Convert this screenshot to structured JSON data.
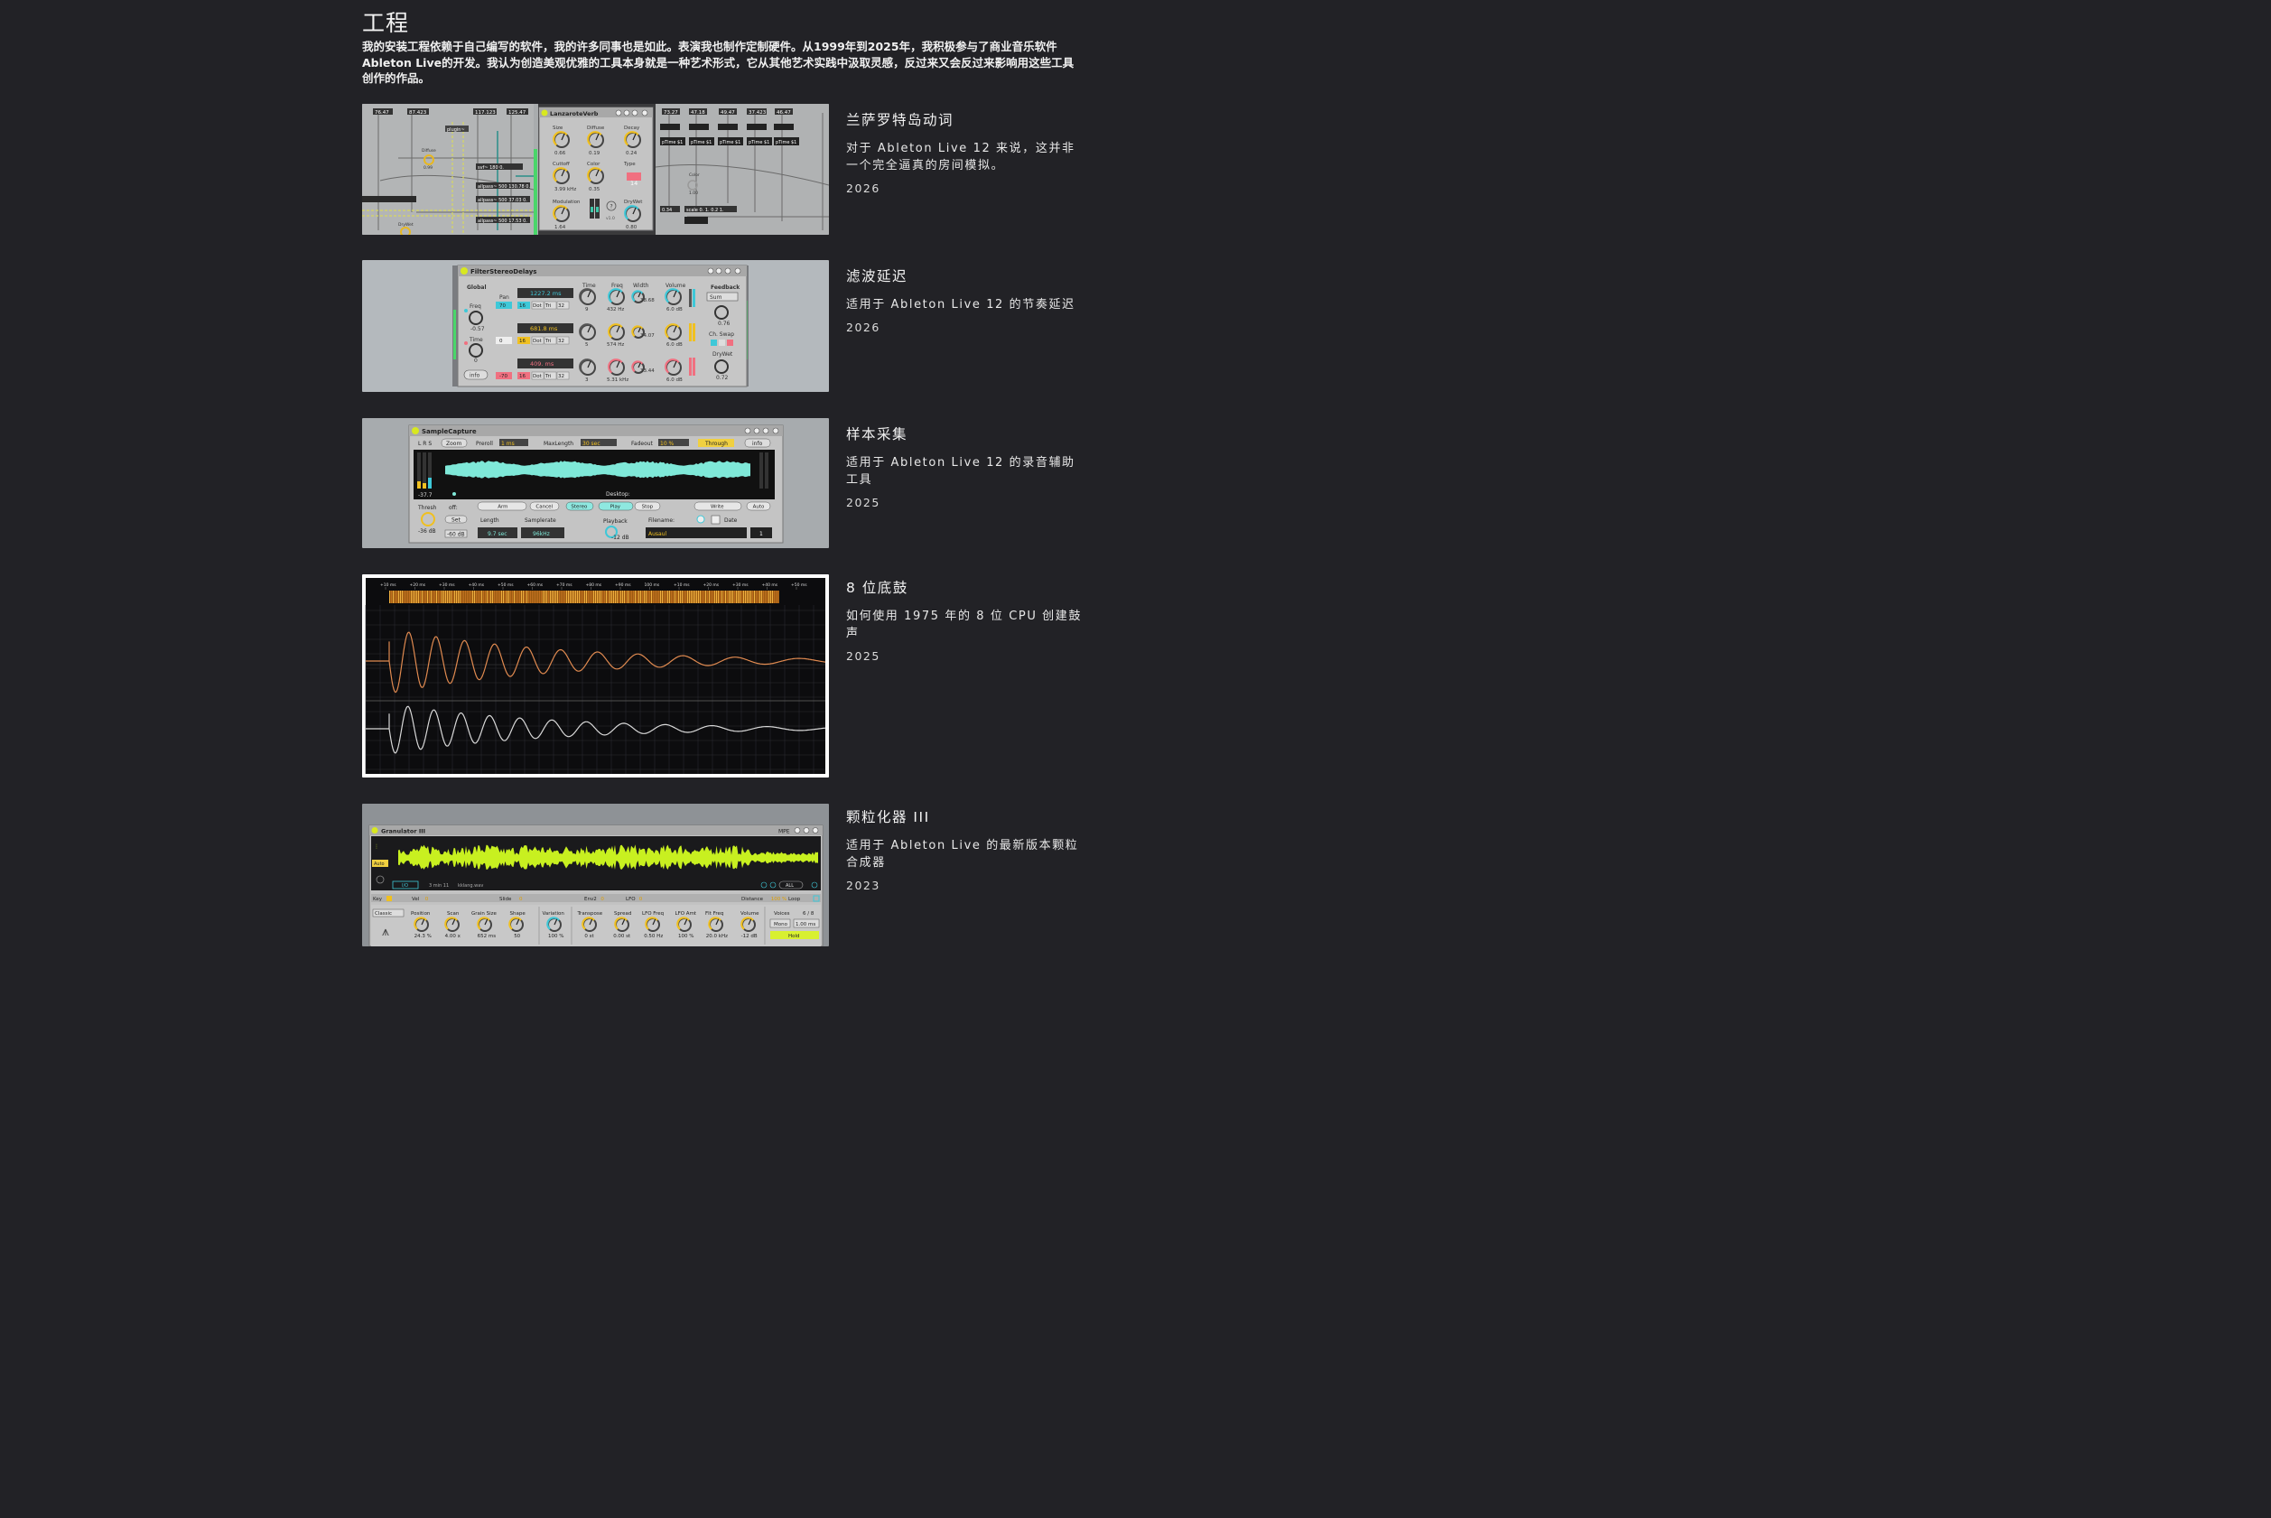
{
  "page": {
    "title": "工程",
    "intro": "我的安装工程依赖于自己编写的软件，我的许多同事也是如此。表演我也制作定制硬件。从1999年到2025年，我积极参与了商业音乐软件Ableton Live的开发。我认为创造美观优雅的工具本身就是一种艺术形式，它从其他艺术实践中汲取灵感，反过来又会反过来影响用这些工具创作的作品。"
  },
  "projects": [
    {
      "title": "兰萨罗特岛动词",
      "desc": "对于 Ableton Live 12 来说，这并非一个完全逼真的房间模拟。",
      "year": "2026",
      "device": {
        "name": "LanzaroteVerb",
        "knobs": [
          {
            "label": "Size",
            "value": "0.66"
          },
          {
            "label": "Diffuse",
            "value": "0.19"
          },
          {
            "label": "Decay",
            "value": "0.24"
          },
          {
            "label": "Cuttoff",
            "value": "3.99 kHz"
          },
          {
            "label": "Color",
            "value": "0.35"
          },
          {
            "label": "Type",
            "value": "14"
          },
          {
            "label": "Modulation",
            "value": "1.64"
          },
          {
            "label": "DryWet",
            "value": "0.80"
          }
        ],
        "patch_numbers": [
          "76.47",
          "87.423",
          "117.123",
          "125.47",
          "73.27",
          "47.18",
          "49.47",
          "37.423",
          "46.47"
        ],
        "patch_labels": [
          "svf~ 180 0.",
          "allpass~ 500 130.78 0.",
          "allpass~ 500 37.03 0.",
          "allpass~ 500 17.53 0.",
          "plugin~",
          "Diffuse",
          "DryWet",
          "scale 0. 1. 0.2 1.",
          "pTime $1",
          "Color",
          "1.00",
          "0.99",
          "0.34",
          "v1.0"
        ]
      }
    },
    {
      "title": "滤波延迟",
      "desc": "适用于 Ableton Live 12 的节奏延迟",
      "year": "2026",
      "device": {
        "name": "FilterStereoDelays",
        "global_label": "Global",
        "freq_label": "Freq",
        "freq_value": "-0.57",
        "time_label": "Time",
        "time_value": "0",
        "info_label": "info",
        "pan_label": "Pan",
        "col_labels": [
          "Time",
          "Freq",
          "Width",
          "Volume"
        ],
        "feedback_label": "Feedback",
        "feedback_mode": "Sum",
        "feedback_value": "0.76",
        "chswap_label": "Ch. Swap",
        "drywet_label": "DryWet",
        "drywet_value": "0.72",
        "rows": [
          {
            "delay": "1227.2 ms",
            "pan": "70",
            "div": "16",
            "time": "9",
            "freq": "432 Hz",
            "width": "38.68",
            "vol": "6.0 dB",
            "color": "#3ec8d8"
          },
          {
            "delay": "681.8 ms",
            "pan": "0",
            "div": "16",
            "time": "5",
            "freq": "574 Hz",
            "width": "34.07",
            "vol": "6.0 dB",
            "color": "#f0c020"
          },
          {
            "delay": "409. ms",
            "pan": "-70",
            "div": "16",
            "time": "3",
            "freq": "5.31 kHz",
            "width": "33.44",
            "vol": "6.0 dB",
            "color": "#f07080"
          }
        ],
        "modes": [
          "Dot",
          "Tri",
          "32"
        ]
      }
    },
    {
      "title": "样本采集",
      "desc": "适用于 Ableton Live 12 的录音辅助工具",
      "year": "2025",
      "device": {
        "name": "SampleCapture",
        "top_labels": [
          "L R S",
          "Zoom",
          "Preroll",
          "1 ms",
          "MaxLength",
          "30 sec",
          "Fadeout",
          "10 %",
          "Through",
          "info"
        ],
        "meter_value": "-37.7",
        "desktop_label": "Desktop:",
        "thresh_label": "Thresh",
        "thresh_value": "-36 dB",
        "off_label": "off:",
        "set_label": "Set",
        "db60_label": "-60 dB",
        "length_label": "Length",
        "length_value": "9.7 sec",
        "samplerate_label": "Samplerate",
        "samplerate_value": "96kHz",
        "buttons": [
          "Arm",
          "Cancel",
          "Stereo",
          "Play",
          "Stop",
          "Write",
          "Auto"
        ],
        "playback_label": "Playback",
        "playback_value": "-12 dB",
        "filename_label": "Filename:",
        "date_label": "Date",
        "filename_value": "Ausaul",
        "counter": "1"
      }
    },
    {
      "title": "8 位底鼓",
      "desc": "如何使用 1975 年的 8 位 CPU 创建鼓声",
      "year": "2025",
      "device": {
        "ruler": [
          "+10 ms",
          "+20 ms",
          "+30 ms",
          "+40 ms",
          "+50 ms",
          "+60 ms",
          "+70 ms",
          "+80 ms",
          "+90 ms",
          "100 ms",
          "+10 ms",
          "+20 ms",
          "+30 ms",
          "+40 ms",
          "+50 ms"
        ]
      }
    },
    {
      "title": "颗粒化器 III",
      "desc": "适用于 Ableton Live 的最新版本颗粒合成器",
      "year": "2023",
      "device": {
        "name": "Granulator III",
        "mpe": "MPE",
        "auto_label": "Auto",
        "io_label": "I/O",
        "duration": "3 min 11",
        "file": "kklang.wav",
        "all_label": "ALL",
        "mod_row": [
          {
            "label": "Key",
            "value": ""
          },
          {
            "label": "Vel",
            "value": "0"
          },
          {
            "label": "Slide",
            "value": "0"
          },
          {
            "label": "Env2",
            "value": "0"
          },
          {
            "label": "LFO",
            "value": "0"
          },
          {
            "label": "Distance",
            "value": "100 %"
          },
          {
            "label": "Loop",
            "value": ""
          }
        ],
        "mode": "Classic",
        "knobs": [
          {
            "label": "Position",
            "value": "24.3 %"
          },
          {
            "label": "Scan",
            "value": "4.00 x"
          },
          {
            "label": "Grain Size",
            "value": "652 ms"
          },
          {
            "label": "Shape",
            "value": "50"
          },
          {
            "label": "Variation",
            "value": "100 %"
          },
          {
            "label": "Transpose",
            "value": "0 st"
          },
          {
            "label": "Spread",
            "value": "0.00 st"
          },
          {
            "label": "LFO Freq",
            "value": "0.50 Hz"
          },
          {
            "label": "LFO Amt",
            "value": "100 %"
          },
          {
            "label": "Flt Freq",
            "value": "20.0 kHz"
          },
          {
            "label": "Volume",
            "value": "-12 dB"
          }
        ],
        "voices_label": "Voices",
        "voices_value": "6 / 8",
        "mono_label": "Mono",
        "glide_value": "1.00 ms",
        "hold_label": "Hold"
      }
    }
  ],
  "colors": {
    "background": "#222226",
    "knob_yellow": "#f0c020",
    "knob_cyan": "#3ec8d8",
    "knob_pink": "#f07080",
    "wave_cyan": "#7fe8d8",
    "wave_green": "#c8f020",
    "wave_orange": "#e08a50",
    "wave_white": "#d8d8d8"
  }
}
